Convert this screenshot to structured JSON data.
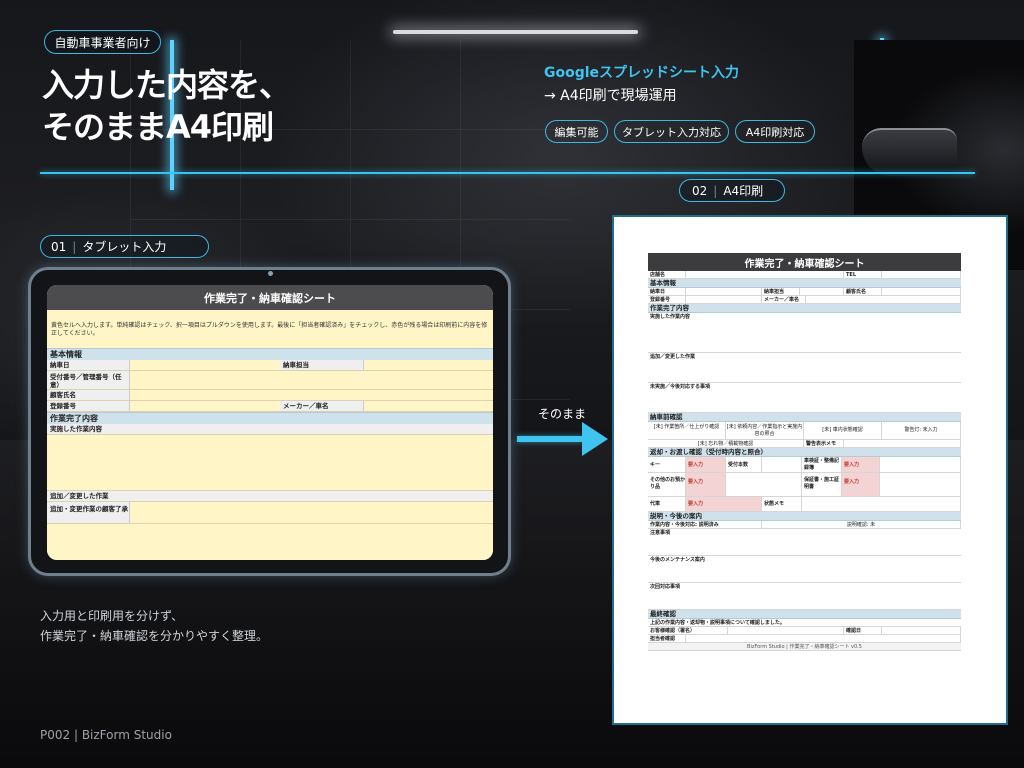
{
  "header": {
    "audience_badge": "自動車事業者向け",
    "title_line1": "入力した内容を、",
    "title_line2": "そのままA4印刷",
    "subtitle_line1": "Googleスプレッドシート入力",
    "subtitle_line2": "→ A4印刷で現場運用",
    "tags": [
      "編集可能",
      "タブレット入力対応",
      "A4印刷対応"
    ]
  },
  "step1": {
    "number": "01",
    "label": "タブレット入力"
  },
  "step2": {
    "number": "02",
    "label": "A4印刷"
  },
  "arrow_label": "そのまま",
  "caption": {
    "line1": "入力用と印刷用を分けず、",
    "line2": "作業完了・納車確認を分かりやすく整理。"
  },
  "footer": "P002 | BizForm Studio",
  "tablet_sheet": {
    "title": "作業完了・納車確認シート",
    "note": "黄色セルへ入力します。単純確認はチェック、択一項目はプルダウンを使用します。最後に「担当者確認済み」をチェックし、赤色が残る場合は印刷前に内容を修正してください。",
    "section_basic": "基本情報",
    "f_date": "納車日",
    "f_staff": "納車担当",
    "f_order": "受付番号／管理番号（任意）",
    "f_customer": "顧客氏名",
    "f_reg": "登録番号",
    "f_maker": "メーカー／車名",
    "section_work": "作業完了内容",
    "f_work_done": "実施した作業内容",
    "f_added": "追加／変更した作業",
    "f_added_consent": "追加・変更作業の顧客了承"
  },
  "print_sheet": {
    "title": "作業完了・納車確認シート",
    "store": "店舗名",
    "tel": "TEL",
    "sec_basic": "基本情報",
    "delivery_date": "納車日",
    "delivery_staff": "納車担当",
    "customer": "顧客氏名",
    "reg": "登録番号",
    "maker": "メーカー／車名",
    "sec_work": "作業完了内容",
    "work_done": "実施した作業内容",
    "added": "追加／変更した作業",
    "pending": "未実施／今後対応する事項",
    "sec_pre": "納車前確認",
    "chk1": "[未] 作業箇所／仕上がり確認",
    "chk2": "[未] 依頼内容／作業指示と実施内容の照合",
    "chk3": "[未] 車内状態確認",
    "chk4": "警告灯: 未入力",
    "chk5": "[未] 忘れ物／積載物確認",
    "chk6": "警告表示メモ",
    "sec_return": "返却・お渡し確認（受付時内容と照合）",
    "key": "キー",
    "req": "要入力",
    "key_count": "受付本数",
    "inspection": "車検証・整備記録簿",
    "other": "その他のお預かり品",
    "warranty": "保証書・施工証明書",
    "loaner": "代車",
    "condition_memo": "状態メモ",
    "sec_explain": "説明・今後の案内",
    "explain_done": "作業内容・今後対応: 説明済み",
    "explain_check": "説明確認: 未",
    "notes": "注意事項",
    "maintenance": "今後のメンテナンス案内",
    "next": "次回対応事項",
    "sec_final": "最終確認",
    "final_text": "上記の作業内容・返却物・説明事項について確認しました。",
    "signature": "お客様確認（署名）",
    "confirm_date": "確認日",
    "staff_confirm": "担当者確認",
    "doc_footer": "BizForm Studio | 作業完了・納車確認シート v0.5"
  }
}
